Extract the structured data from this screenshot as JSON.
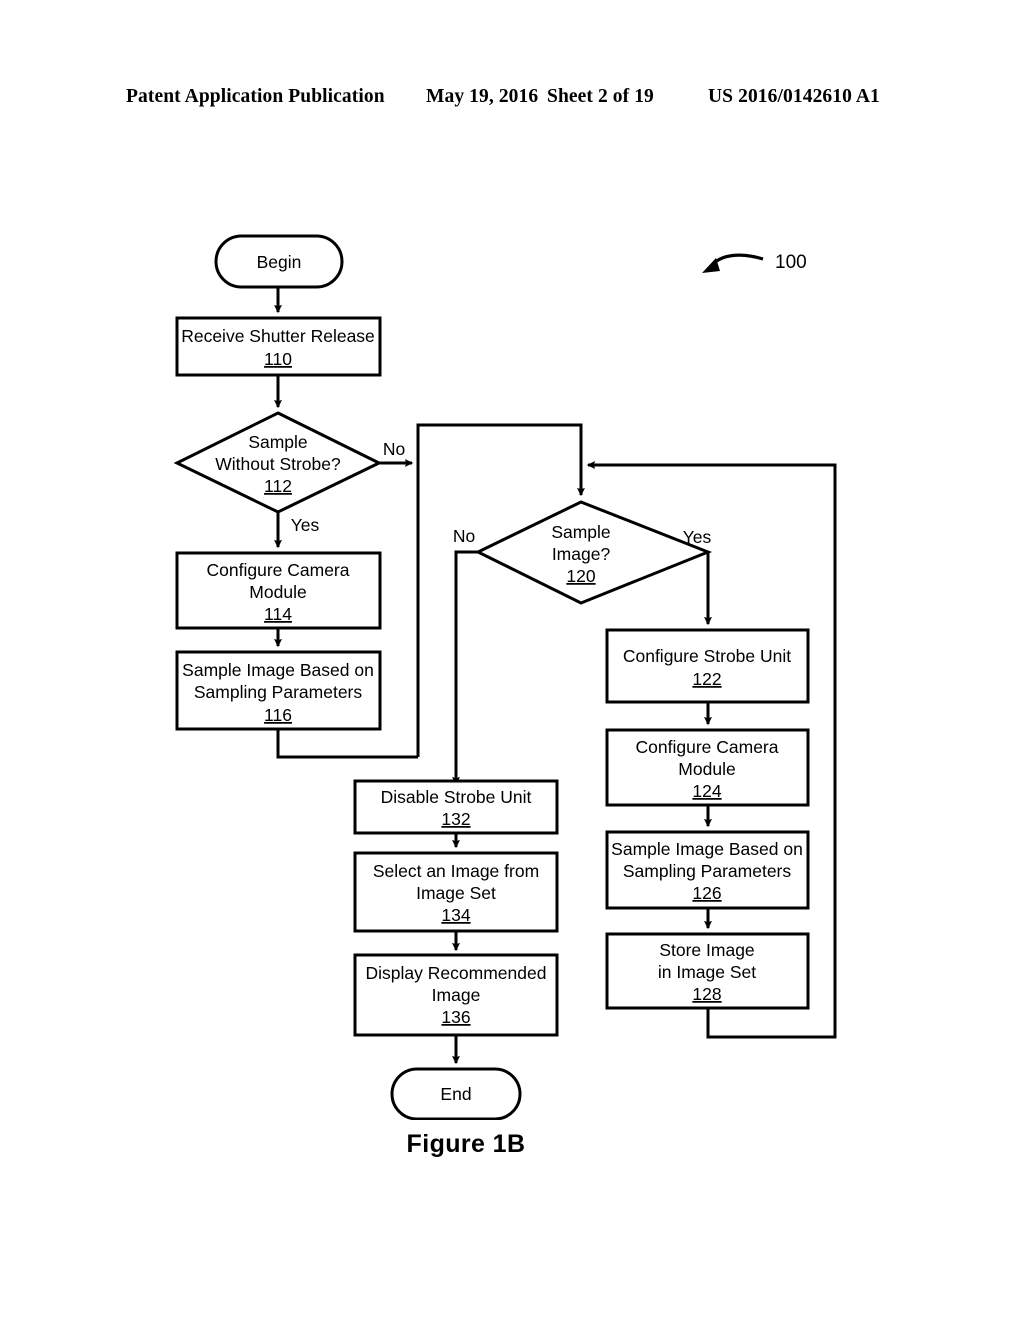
{
  "header": {
    "publication": "Patent Application Publication",
    "date": "May 19, 2016",
    "sheet": "Sheet 2 of 19",
    "patent_number": "US 2016/0142610 A1"
  },
  "figure": {
    "caption": "Figure 1B",
    "reference_numeral": "100"
  },
  "flowchart": {
    "begin": {
      "label": "Begin"
    },
    "end": {
      "label": "End"
    },
    "steps": [
      {
        "id": "110",
        "lines": [
          "Receive Shutter Release"
        ],
        "ref": "110",
        "shape": "process"
      },
      {
        "id": "112",
        "lines": [
          "Sample",
          "Without Strobe?"
        ],
        "ref": "112",
        "shape": "decision"
      },
      {
        "id": "114",
        "lines": [
          "Configure Camera",
          "Module"
        ],
        "ref": "114",
        "shape": "process"
      },
      {
        "id": "116",
        "lines": [
          "Sample Image Based on",
          "Sampling Parameters"
        ],
        "ref": "116",
        "shape": "process"
      },
      {
        "id": "120",
        "lines": [
          "Sample",
          "Image?"
        ],
        "ref": "120",
        "shape": "decision"
      },
      {
        "id": "122",
        "lines": [
          "Configure Strobe Unit"
        ],
        "ref": "122",
        "shape": "process"
      },
      {
        "id": "124",
        "lines": [
          "Configure Camera",
          "Module"
        ],
        "ref": "124",
        "shape": "process"
      },
      {
        "id": "126",
        "lines": [
          "Sample Image Based on",
          "Sampling Parameters"
        ],
        "ref": "126",
        "shape": "process"
      },
      {
        "id": "128",
        "lines": [
          "Store Image",
          "in Image Set"
        ],
        "ref": "128",
        "shape": "process"
      },
      {
        "id": "132",
        "lines": [
          "Disable Strobe Unit"
        ],
        "ref": "132",
        "shape": "process"
      },
      {
        "id": "134",
        "lines": [
          "Select an Image from",
          "Image Set"
        ],
        "ref": "134",
        "shape": "process"
      },
      {
        "id": "136",
        "lines": [
          "Display Recommended",
          "Image"
        ],
        "ref": "136",
        "shape": "process"
      }
    ],
    "branch_labels": {
      "d112_no": "No",
      "d112_yes": "Yes",
      "d120_no": "No",
      "d120_yes": "Yes"
    }
  },
  "colors": {
    "ink": "#000000",
    "paper": "#ffffff"
  }
}
